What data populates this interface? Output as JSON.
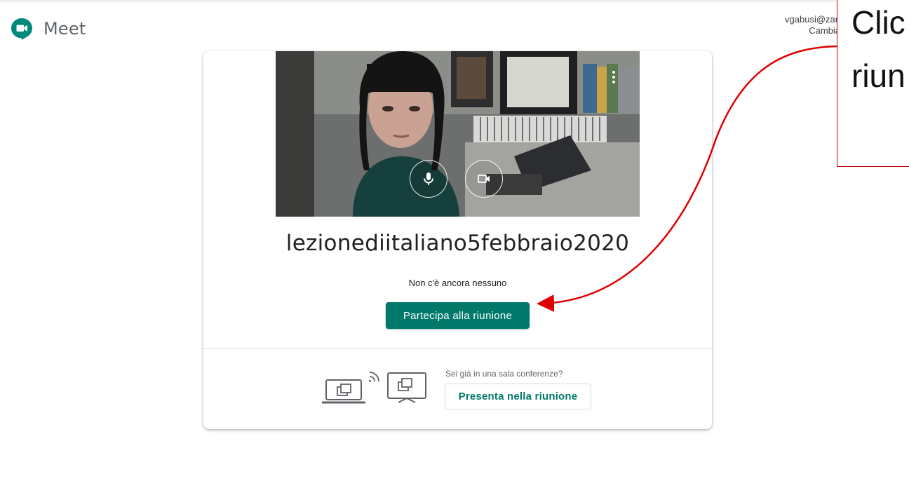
{
  "app": {
    "name": "Meet"
  },
  "account": {
    "email": "vgabusi@zan",
    "switch_label": "Cambia"
  },
  "meeting": {
    "code": "lezionediitaliano5febbraio2020",
    "status": "Non c'è ancora nessuno",
    "join_label": "Partecipa alla riunione"
  },
  "conference_room": {
    "question": "Sei già in una sala conferenze?",
    "present_label": "Presenta nella riunione"
  },
  "annotation": {
    "line1": "Clic",
    "line2": "riun"
  },
  "icons": {
    "logo": "meet-logo-icon",
    "more": "more-vert-icon",
    "mic": "microphone-icon",
    "camera": "camera-icon",
    "cast": "cast-to-screen-icon"
  },
  "colors": {
    "accent": "#00796b",
    "annotation": "#e00000",
    "logo": "#00897b"
  }
}
